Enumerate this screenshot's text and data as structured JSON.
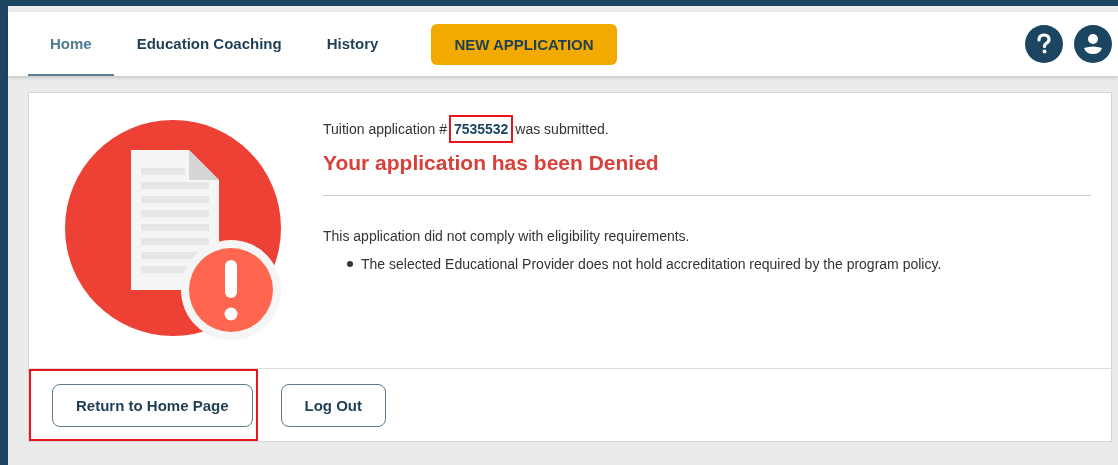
{
  "nav": {
    "tabs": [
      {
        "label": "Home",
        "selected": true
      },
      {
        "label": "Education Coaching",
        "selected": false
      },
      {
        "label": "History",
        "selected": false
      }
    ],
    "new_application": "NEW APPLICATION"
  },
  "result": {
    "submission": {
      "before": "Tuition application #",
      "number": "7535532",
      "after": "was submitted.",
      "highlighted": true
    },
    "status": "Your application has been Denied",
    "explanation": "This application did not comply with eligibility requirements.",
    "reasons": [
      "The selected Educational Provider does not hold accreditation required by the program policy."
    ]
  },
  "buttons": [
    {
      "label": "Return to Home Page",
      "highlighted": true
    },
    {
      "label": "Log Out",
      "highlighted": false
    }
  ]
}
